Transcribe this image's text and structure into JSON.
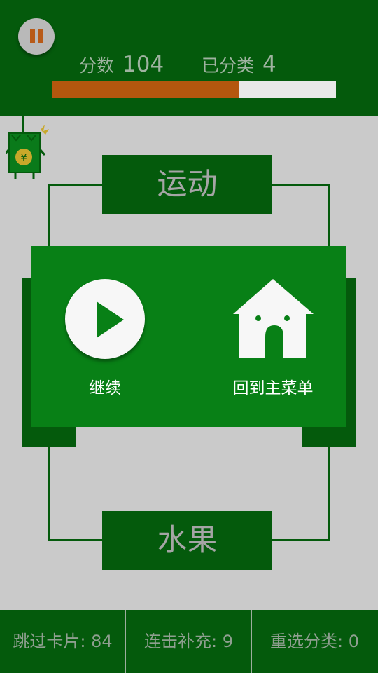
{
  "header": {
    "score_label": "分数",
    "score_value": "104",
    "sorted_label": "已分类",
    "sorted_value": "4",
    "progress_fraction": 0.66
  },
  "categories": {
    "top": "运动",
    "bottom": "水果"
  },
  "pause_dialog": {
    "resume_label": "继续",
    "home_label": "回到主菜单"
  },
  "powerups": {
    "skip_label": "跳过卡片: 84",
    "combo_label": "连击补充: 9",
    "reselect_label": "重选分类: 0"
  },
  "mascot": {
    "currency_symbol": "¥"
  },
  "colors": {
    "dark_green": "#045a0c",
    "dialog_green": "#088016",
    "progress_orange": "#b4570e",
    "background_gray": "#cacaca"
  }
}
